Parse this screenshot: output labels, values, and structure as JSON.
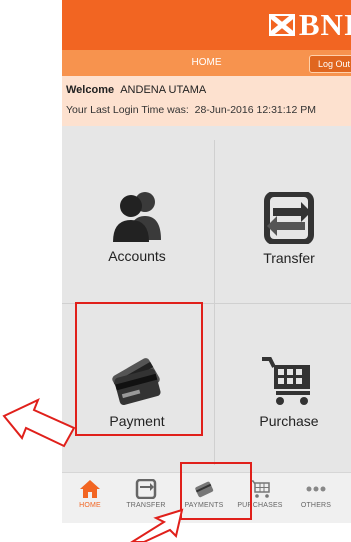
{
  "brand": {
    "logo_text": "BNI",
    "color": "#f26522"
  },
  "navbar": {
    "title": "HOME",
    "logout_label": "Log Out"
  },
  "welcome": {
    "greeting": "Welcome",
    "user_name": "ANDENA UTAMA",
    "last_login_label": "Your Last Login Time was:",
    "last_login_time": "28-Jun-2016 12:31:12 PM"
  },
  "menu": {
    "accounts": "Accounts",
    "transfer": "Transfer",
    "payment": "Payment",
    "purchase": "Purchase"
  },
  "tabs": [
    {
      "label": "HOME",
      "icon": "home-icon",
      "active": true
    },
    {
      "label": "TRANSFER",
      "icon": "transfer-icon"
    },
    {
      "label": "PAYMENTS",
      "icon": "payment-icon"
    },
    {
      "label": "PURCHASES",
      "icon": "cart-icon"
    },
    {
      "label": "OTHERS",
      "icon": "more-icon"
    }
  ],
  "colors": {
    "accent": "#f26522",
    "annotation": "#e0201b"
  }
}
